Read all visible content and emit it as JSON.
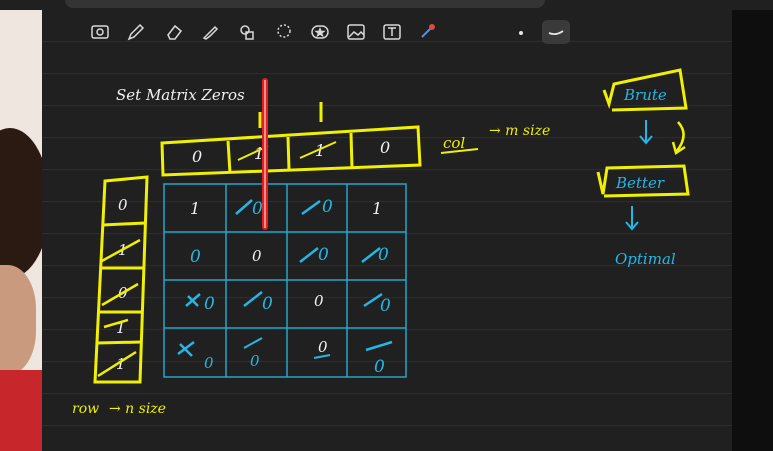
{
  "toolbar": {
    "tools": [
      {
        "name": "screenshot-tool-icon"
      },
      {
        "name": "pen-tool-icon"
      },
      {
        "name": "eraser-tool-icon"
      },
      {
        "name": "highlighter-tool-icon"
      },
      {
        "name": "shapes-tool-icon"
      },
      {
        "name": "lasso-tool-icon"
      },
      {
        "name": "sticker-tool-icon"
      },
      {
        "name": "image-tool-icon"
      },
      {
        "name": "text-tool-icon"
      },
      {
        "name": "laser-pointer-icon"
      }
    ],
    "active_tool": "pen-size-stroke-icon"
  },
  "note": {
    "title": "Set Matrix Zeros",
    "col_label": "col",
    "col_size": "→ m size",
    "row_label": "row",
    "row_size": "→ n size",
    "approaches": [
      "Brute",
      "Better",
      "Optimal"
    ],
    "col_array": [
      "0",
      "1",
      "1",
      "0"
    ],
    "row_array": [
      "0",
      "1",
      "0",
      "1",
      "1"
    ],
    "matrix": [
      [
        "1",
        "0",
        "0",
        "1"
      ],
      [
        "0",
        "0",
        "0",
        "0"
      ],
      [
        "0",
        "0",
        "0",
        "0"
      ],
      [
        "0",
        "0",
        "0",
        "0"
      ]
    ]
  },
  "colors": {
    "canvas": "#202020",
    "yellow_ink": "#f0f000",
    "blue_ink": "#22b7e6",
    "white_ink": "#f2f2f2",
    "red_highlight": "#e02020"
  }
}
